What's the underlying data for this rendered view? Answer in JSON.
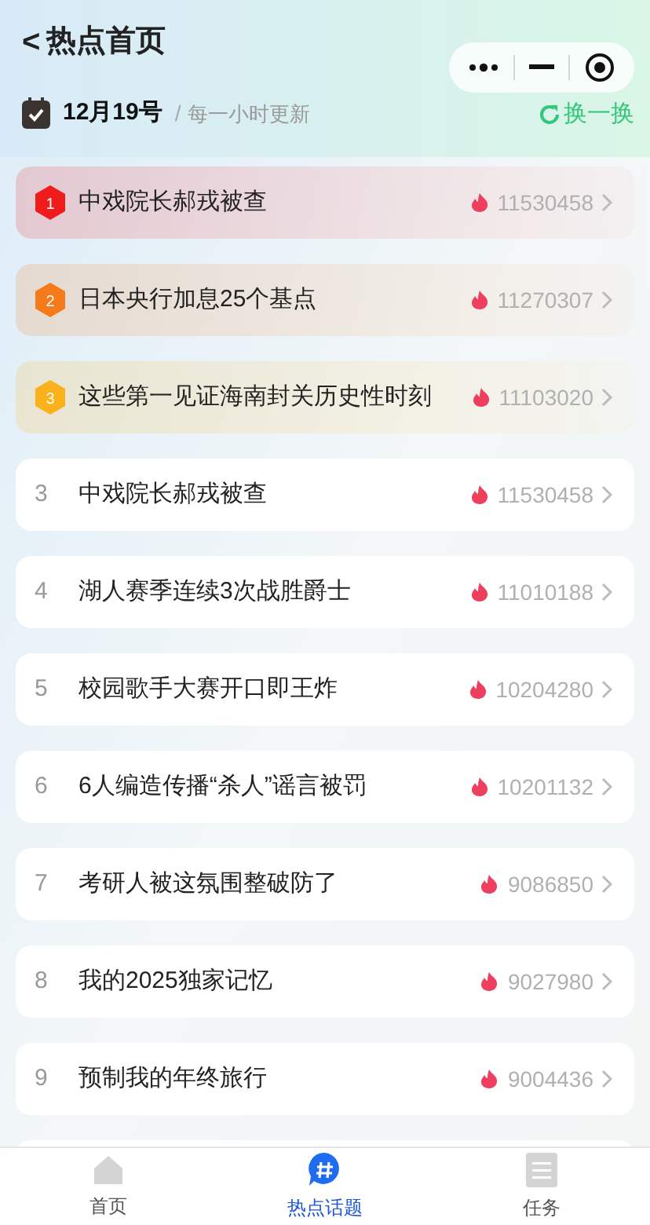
{
  "header": {
    "back": "<",
    "title": "热点首页",
    "date": "12月19号",
    "separator": "/",
    "subtitle": "每一小时更新",
    "refresh": "换一换"
  },
  "items": [
    {
      "kind": "top",
      "rank": "1",
      "color": "#f01c1c",
      "title": "中戏院长郝戎被查",
      "heat": "11530458"
    },
    {
      "kind": "top",
      "rank": "2",
      "color": "#f47a1a",
      "title": "日本央行加息25个基点",
      "heat": "11270307"
    },
    {
      "kind": "top",
      "rank": "3",
      "color": "#fbb11c",
      "title": "这些第一见证海南封关历史性时刻",
      "heat": "11103020"
    },
    {
      "kind": "normal",
      "rank": "3",
      "title": "中戏院长郝戎被查",
      "heat": "11530458"
    },
    {
      "kind": "normal",
      "rank": "4",
      "title": "湖人赛季连续3次战胜爵士",
      "heat": "11010188"
    },
    {
      "kind": "normal",
      "rank": "5",
      "title": "校园歌手大赛开口即王炸",
      "heat": "10204280"
    },
    {
      "kind": "normal",
      "rank": "6",
      "title": "6人编造传播“杀人”谣言被罚",
      "heat": "10201132"
    },
    {
      "kind": "normal",
      "rank": "7",
      "title": "考研人被这氛围整破防了",
      "heat": "9086850"
    },
    {
      "kind": "normal",
      "rank": "8",
      "title": "我的2025独家记忆",
      "heat": "9027980"
    },
    {
      "kind": "normal",
      "rank": "9",
      "title": "预制我的年终旅行",
      "heat": "9004436"
    }
  ],
  "tabs": [
    {
      "label": "首页",
      "kind": "home",
      "selected": false
    },
    {
      "label": "热点话题",
      "kind": "topic",
      "selected": true
    },
    {
      "label": "任务",
      "kind": "task",
      "selected": false
    }
  ]
}
